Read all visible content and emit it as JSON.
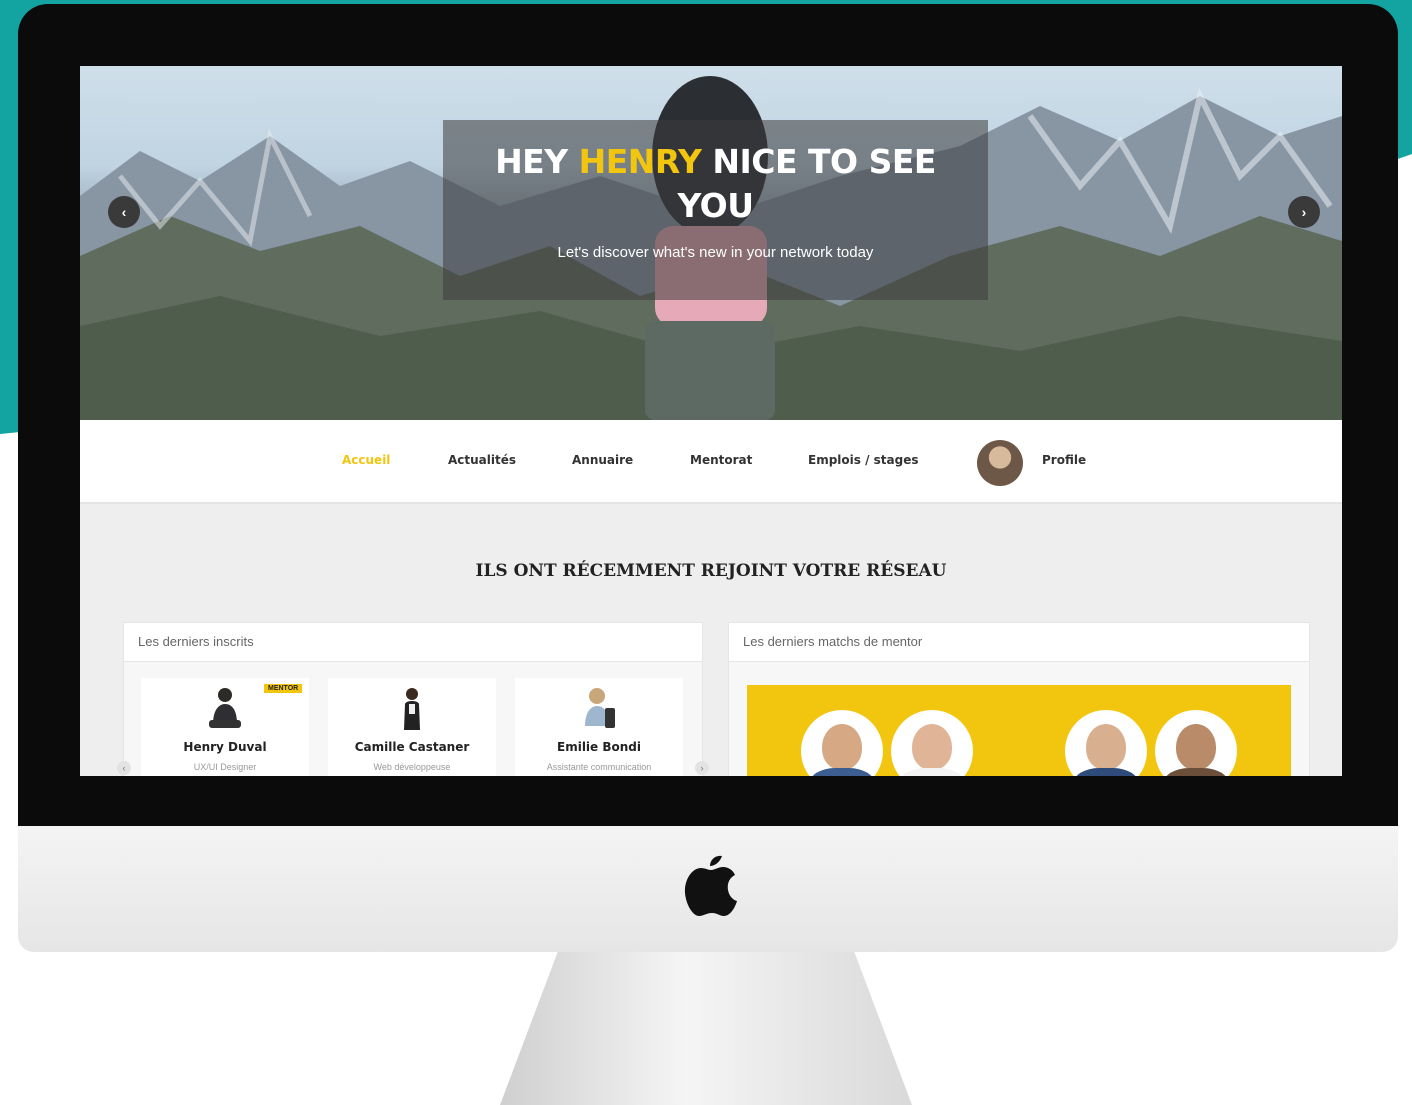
{
  "hero": {
    "title_prefix": "HEY ",
    "title_name": "HENRY",
    "title_suffix": " NICE TO SEE YOU",
    "subtitle": "Let's discover what's new in your network today",
    "prev_arrow": "‹",
    "next_arrow": "›"
  },
  "nav": {
    "items": [
      {
        "label": "Accueil",
        "active": true
      },
      {
        "label": "Actualités",
        "active": false
      },
      {
        "label": "Annuaire",
        "active": false
      },
      {
        "label": "Mentorat",
        "active": false
      },
      {
        "label": "Emplois / stages",
        "active": false
      },
      {
        "label": "Profile",
        "active": false
      }
    ]
  },
  "section": {
    "title": "ILS ONT RÉCEMMENT REJOINT VOTRE RÉSEAU"
  },
  "latest_members": {
    "heading": "Les derniers inscrits",
    "members": [
      {
        "name": "Henry Duval",
        "role": "UX/UI Designer",
        "badge": "MENTOR"
      },
      {
        "name": "Camille Castaner",
        "role": "Web développeuse",
        "badge": ""
      },
      {
        "name": "Emilie Bondi",
        "role": "Assistante communication",
        "badge": ""
      }
    ],
    "prev_arrow": "‹",
    "next_arrow": "›"
  },
  "mentor_matches": {
    "heading": "Les derniers matchs de mentor"
  },
  "colors": {
    "accent": "#f2c50f",
    "teal": "#13a3a0"
  }
}
